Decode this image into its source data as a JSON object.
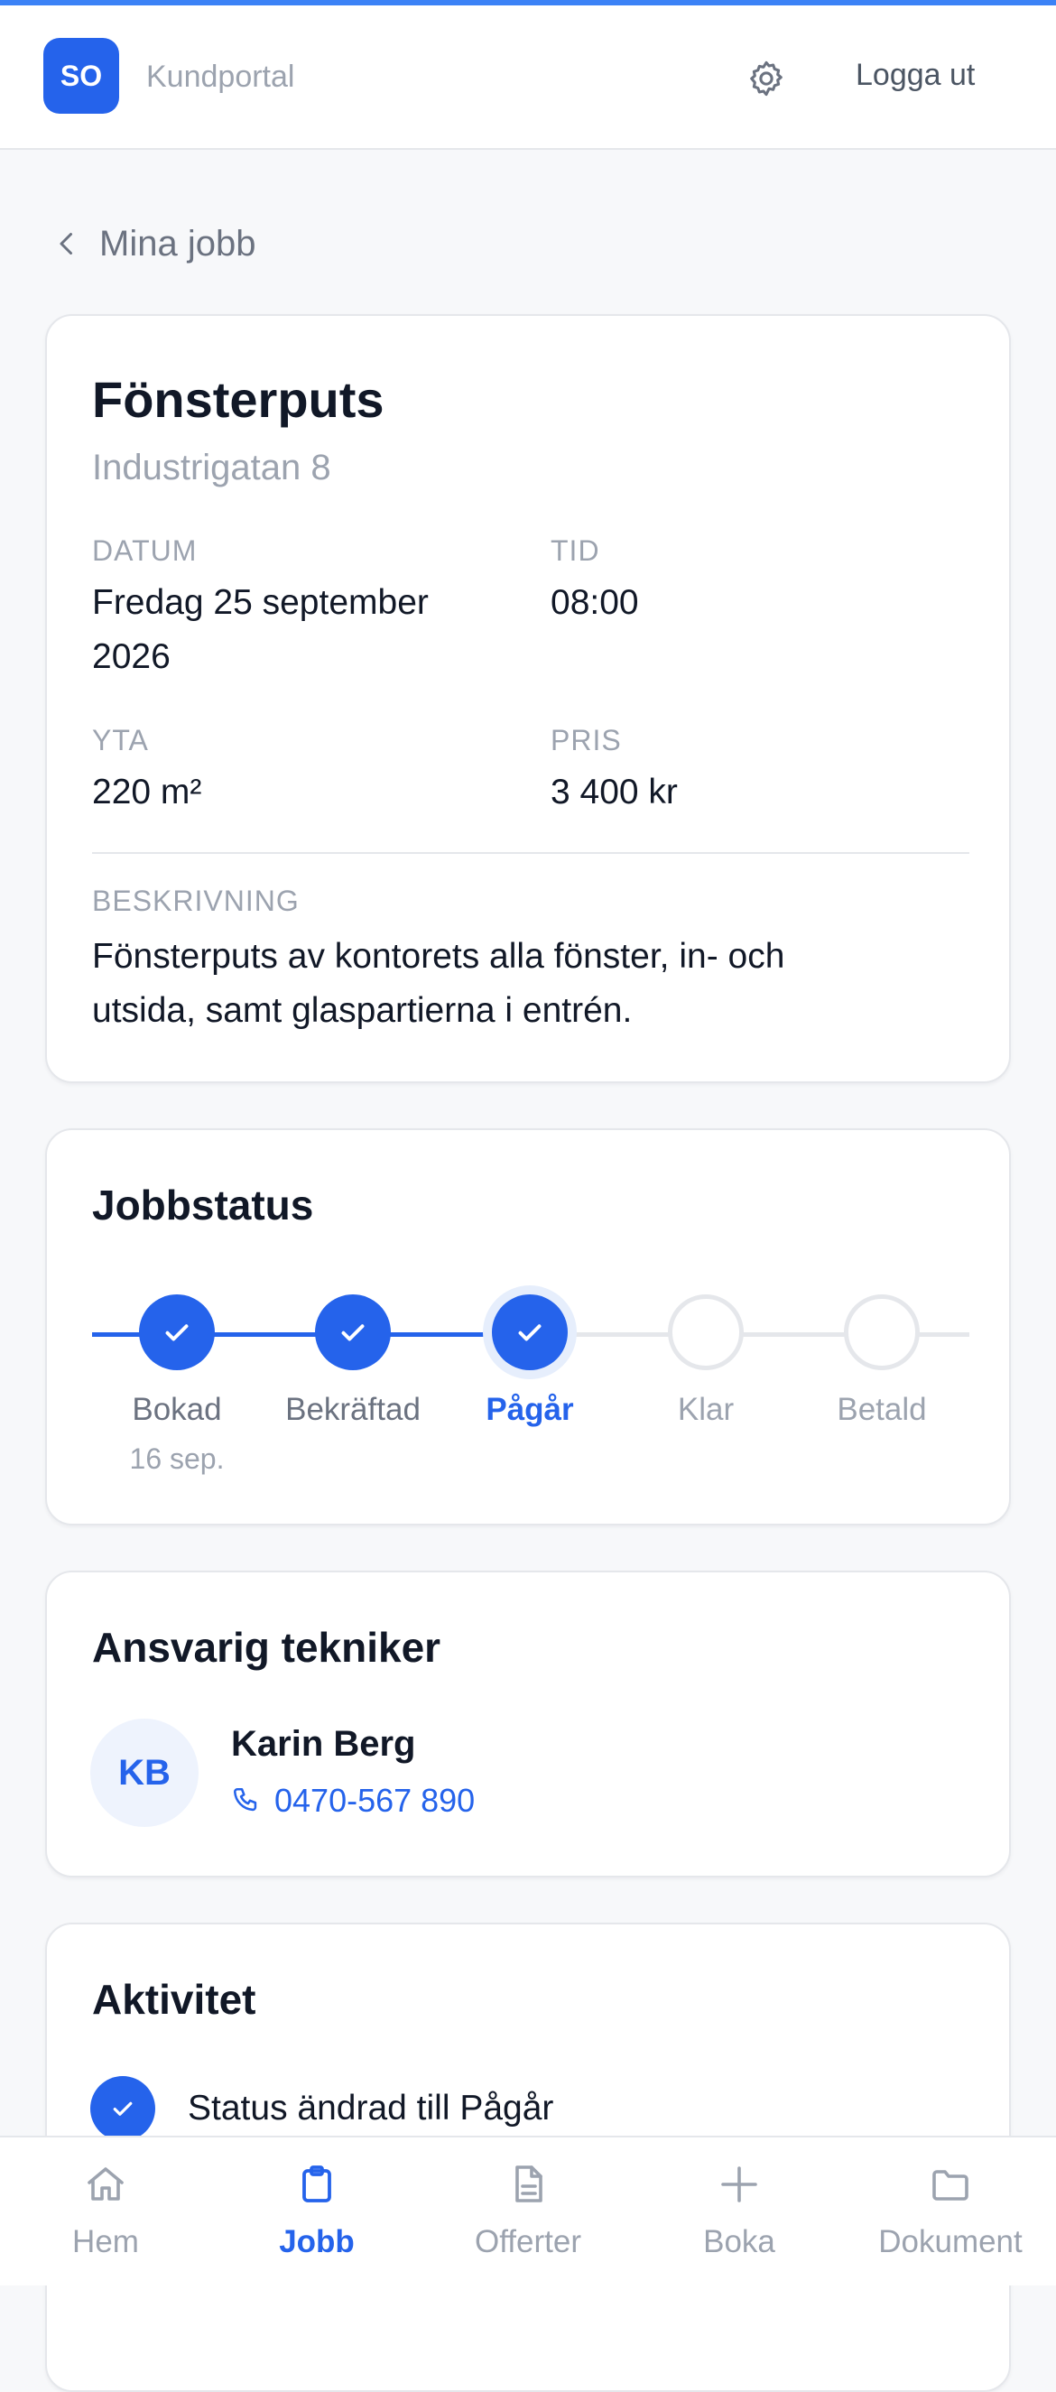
{
  "header": {
    "logo_initials": "SO",
    "portal_name": "Kundportal",
    "logout_label": "Logga ut",
    "settings_icon": "gear-icon"
  },
  "back_link": {
    "label": "Mina jobb",
    "icon": "chevron-left-icon"
  },
  "job": {
    "title": "Fönsterputs",
    "address": "Industrigatan 8",
    "date_label": "DATUM",
    "date_line1": "Fredag 25 september",
    "date_line2": "2026",
    "time_label": "TID",
    "time_value": "08:00",
    "area_label": "YTA",
    "area_value": "220 m²",
    "price_label": "PRIS",
    "price_value": "3 400 kr",
    "description_label": "BESKRIVNING",
    "description_line1": "Fönsterputs av kontorets alla fönster, in- och",
    "description_line2": "utsida, samt glaspartierna i entrén."
  },
  "status": {
    "title": "Jobbstatus",
    "steps": [
      {
        "label": "Bokad",
        "date": "16 sep.",
        "state": "done"
      },
      {
        "label": "Bekräftad",
        "date": "",
        "state": "done"
      },
      {
        "label": "Pågår",
        "date": "",
        "state": "current"
      },
      {
        "label": "Klar",
        "date": "",
        "state": "todo"
      },
      {
        "label": "Betald",
        "date": "",
        "state": "todo"
      }
    ]
  },
  "technician": {
    "title": "Ansvarig tekniker",
    "initials": "KB",
    "name": "Karin Berg",
    "phone": "0470-567 890",
    "phone_icon": "phone-icon"
  },
  "activity": {
    "title": "Aktivitet",
    "items": [
      {
        "text": "Status ändrad till Pågår",
        "icon": "check-icon"
      }
    ]
  },
  "nav": {
    "items": [
      {
        "label": "Hem",
        "icon": "home-icon",
        "active": false
      },
      {
        "label": "Jobb",
        "icon": "clipboard-icon",
        "active": true
      },
      {
        "label": "Offerter",
        "icon": "document-icon",
        "active": false
      },
      {
        "label": "Boka",
        "icon": "plus-icon",
        "active": false
      },
      {
        "label": "Dokument",
        "icon": "folder-icon",
        "active": false
      }
    ]
  },
  "colors": {
    "accent": "#2563eb",
    "top_line": "#3b82f6",
    "muted_text": "#9ca3af",
    "background": "#f7f8fa"
  }
}
